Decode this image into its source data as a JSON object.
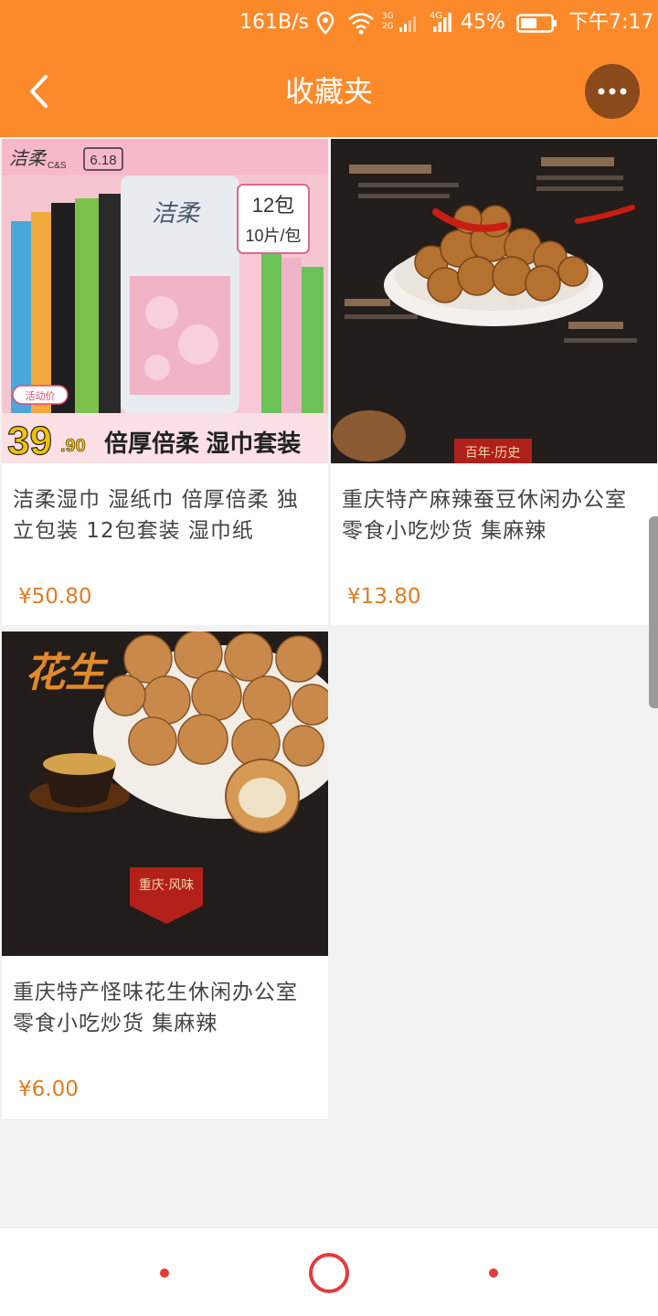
{
  "status_bar": {
    "speed": "161B/s",
    "battery": "45%",
    "time": "下午7:17",
    "net_3g": "3G",
    "net_2g": "2G",
    "net_4g": "4G"
  },
  "header": {
    "title": "收藏夹",
    "back_icon": "chevron-left-icon",
    "more_icon": "more-horizontal-icon"
  },
  "products": [
    {
      "name": "洁柔湿巾 湿纸巾 倍厚倍柔 独立包装 12包套装 湿巾纸",
      "price": "¥50.80",
      "image": {
        "brand": "洁柔",
        "brand_sub": "C&S",
        "event": "6.18",
        "pack_count": "12包",
        "pack_spec": "10片/包",
        "promo_price": "39",
        "promo_decimal": ".90",
        "slogan": "倍厚倍柔 湿巾套装",
        "tag": "活动价"
      }
    },
    {
      "name": "重庆特产麻辣蚕豆休闲办公室零食小吃炒货 集麻辣",
      "price": "¥13.80",
      "image": {
        "label": "百年·历史"
      }
    },
    {
      "name": "重庆特产怪味花生休闲办公室零食小吃炒货 集麻辣",
      "price": "¥6.00",
      "image": {
        "script_text": "花生",
        "seal": "重庆·风味"
      }
    }
  ],
  "colors": {
    "header": "#fc8a2a",
    "price": "#e07c22",
    "nav_accent": "#e23c3c"
  }
}
